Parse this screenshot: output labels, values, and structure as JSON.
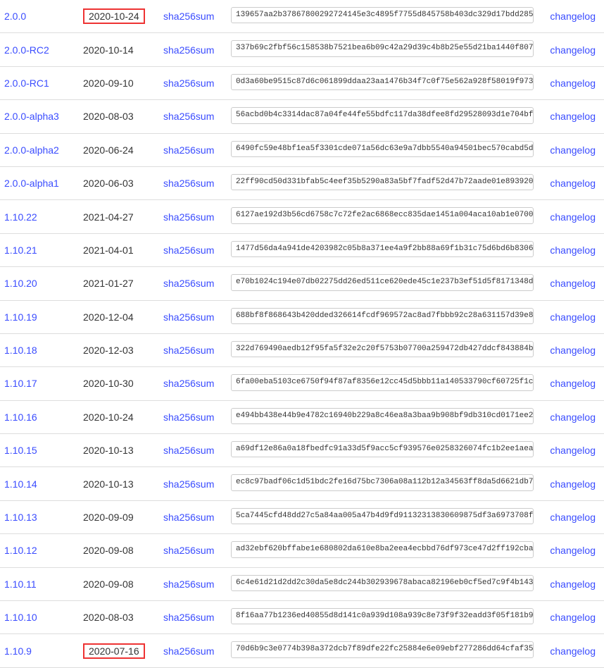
{
  "labels": {
    "sha_link": "sha256sum",
    "changelog": "changelog"
  },
  "releases": [
    {
      "version": "2.0.0",
      "date": "2020-10-24",
      "hash": "139657aa2b37867800292724145e3c4895f7755d845758b403dc329d17bdd285",
      "highlight_date": true
    },
    {
      "version": "2.0.0-RC2",
      "date": "2020-10-14",
      "hash": "337b69c2fbf56c158538b7521bea6b09c42a29d39c4b8b25e55d21ba1440f807",
      "highlight_date": false
    },
    {
      "version": "2.0.0-RC1",
      "date": "2020-09-10",
      "hash": "0d3a60be9515c87d6c061899ddaa23aa1476b34f7c0f75e562a928f58019f973",
      "highlight_date": false
    },
    {
      "version": "2.0.0-alpha3",
      "date": "2020-08-03",
      "hash": "56acbd0b4c3314dac87a04fe44fe55bdfc117da38dfee8fd29528093d1e704bf",
      "highlight_date": false
    },
    {
      "version": "2.0.0-alpha2",
      "date": "2020-06-24",
      "hash": "6490fc59e48bf1ea5f3301cde071a56dc63e9a7dbb5540a94501bec570cabd5d",
      "highlight_date": false
    },
    {
      "version": "2.0.0-alpha1",
      "date": "2020-06-03",
      "hash": "22ff90cd50d331bfab5c4eef35b5290a83a5bf7fadf52d47b72aade01e893920",
      "highlight_date": false
    },
    {
      "version": "1.10.22",
      "date": "2021-04-27",
      "hash": "6127ae192d3b56cd6758c7c72fe2ac6868ecc835dae1451a004aca10ab1e0700",
      "highlight_date": false
    },
    {
      "version": "1.10.21",
      "date": "2021-04-01",
      "hash": "1477d56da4a941de4203982c05b8a371ee4a9f2bb88a69f1b31c75d6bd6b8306",
      "highlight_date": false
    },
    {
      "version": "1.10.20",
      "date": "2021-01-27",
      "hash": "e70b1024c194e07db02275dd26ed511ce620ede45c1e237b3ef51d5f8171348d",
      "highlight_date": false
    },
    {
      "version": "1.10.19",
      "date": "2020-12-04",
      "hash": "688bf8f868643b420dded326614fcdf969572ac8ad7fbbb92c28a631157d39e8",
      "highlight_date": false
    },
    {
      "version": "1.10.18",
      "date": "2020-12-03",
      "hash": "322d769490aedb12f95fa5f32e2c20f5753b07700a259472db427ddcf843884b",
      "highlight_date": false
    },
    {
      "version": "1.10.17",
      "date": "2020-10-30",
      "hash": "6fa00eba5103ce6750f94f87af8356e12cc45d5bbb11a140533790cf60725f1c",
      "highlight_date": false
    },
    {
      "version": "1.10.16",
      "date": "2020-10-24",
      "hash": "e494bb438e44b9e4782c16940b229a8c46ea8a3baa9b908bf9db310cd0171ee2",
      "highlight_date": false
    },
    {
      "version": "1.10.15",
      "date": "2020-10-13",
      "hash": "a69df12e86a0a18fbedfc91a33d5f9acc5cf939576e0258326074fc1b2ee1aea",
      "highlight_date": false
    },
    {
      "version": "1.10.14",
      "date": "2020-10-13",
      "hash": "ec8c97badf06c1d51bdc2fe16d75bc7306a08a112b12a34563ff8da5d6621db7",
      "highlight_date": false
    },
    {
      "version": "1.10.13",
      "date": "2020-09-09",
      "hash": "5ca7445cfd48dd27c5a84aa005a47b4d9fd91132313830609875df3a6973708f",
      "highlight_date": false
    },
    {
      "version": "1.10.12",
      "date": "2020-09-08",
      "hash": "ad32ebf620bffabe1e680802da610e8ba2eea4ecbbd76df973ce47d2ff192cba",
      "highlight_date": false
    },
    {
      "version": "1.10.11",
      "date": "2020-09-08",
      "hash": "6c4e61d21d2dd2c30da5e8dc244b302939678abaca82196eb0cf5ed7c9f4b143",
      "highlight_date": false
    },
    {
      "version": "1.10.10",
      "date": "2020-08-03",
      "hash": "8f16aa77b1236ed40855d8d141c0a939d108a939c8e73f9f32eadd3f05f181b9",
      "highlight_date": false
    },
    {
      "version": "1.10.9",
      "date": "2020-07-16",
      "hash": "70d6b9c3e0774b398a372dcb7f89dfe22fc25884e6e09ebf277286dd64cfaf35",
      "highlight_date": true
    }
  ]
}
